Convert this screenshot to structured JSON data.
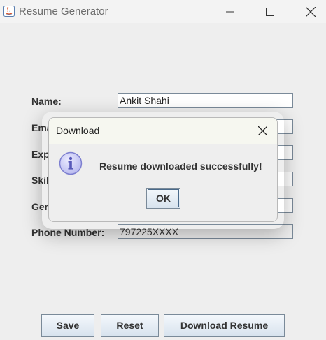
{
  "window": {
    "title": "Resume Generator"
  },
  "form": {
    "fields": [
      {
        "label": "Name:",
        "value": "Ankit Shahi"
      },
      {
        "label": "Ema",
        "value": ""
      },
      {
        "label": "Exp",
        "value": ""
      },
      {
        "label": "Skil",
        "value": ""
      },
      {
        "label": "Ger",
        "value": ""
      },
      {
        "label": "Phone Number:",
        "value": "797225XXXX"
      }
    ]
  },
  "buttons": {
    "save": "Save",
    "reset": "Reset",
    "download": "Download Resume"
  },
  "dialog": {
    "title": "Download",
    "message": "Resume downloaded successfully!",
    "ok": "OK",
    "icon": "info-icon"
  },
  "colors": {
    "window_bg": "#eeeeee",
    "button_gradient_top": "#f4f8fc",
    "button_gradient_bottom": "#d8e3ee",
    "info_icon": "#7d7fd0"
  }
}
